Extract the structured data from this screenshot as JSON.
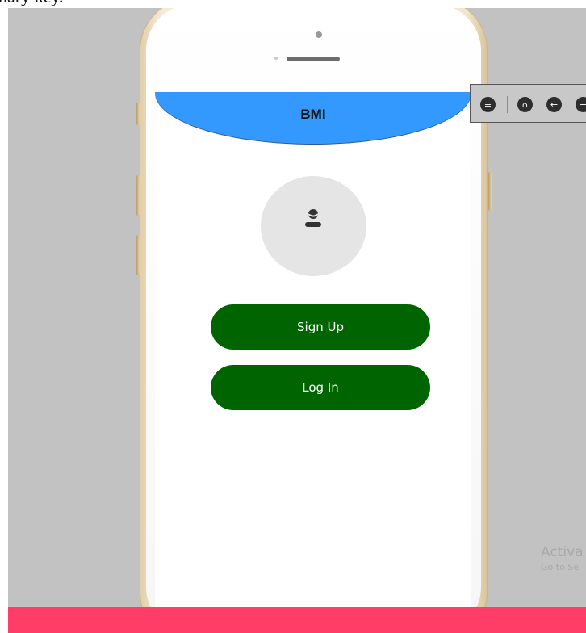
{
  "overlay_top_text": "nary key.",
  "app": {
    "header_title": "BMI",
    "avatar_icon": "user-icon",
    "buttons": {
      "signup_label": "Sign Up",
      "login_label": "Log In"
    }
  },
  "toolbar": {
    "icons": [
      "menu-icon",
      "home-icon",
      "back-arrow-icon",
      "minus-icon"
    ]
  },
  "watermark": {
    "title": "Activa",
    "subtitle": "Go to Se"
  },
  "colors": {
    "header_blue": "#3399ff",
    "button_green": "#006400",
    "bottom_bar_pink": "#ff3d66",
    "background_gray": "#c2c2c2"
  }
}
